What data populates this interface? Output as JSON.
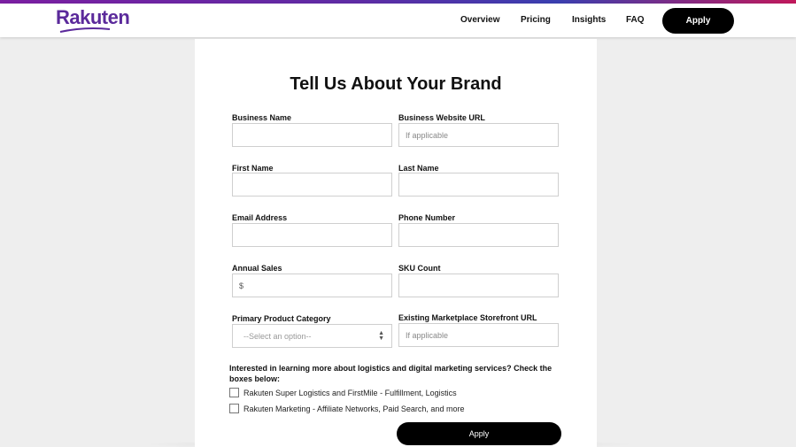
{
  "header": {
    "logo_text": "Rakuten",
    "nav": {
      "overview": "Overview",
      "pricing": "Pricing",
      "insights": "Insights",
      "faq": "FAQ"
    },
    "apply_label": "Apply"
  },
  "form": {
    "title": "Tell Us About Your Brand",
    "fields": {
      "business_name": {
        "label": "Business Name",
        "placeholder": ""
      },
      "business_website": {
        "label": "Business Website URL",
        "placeholder": "If applicable"
      },
      "first_name": {
        "label": "First Name",
        "placeholder": ""
      },
      "last_name": {
        "label": "Last Name",
        "placeholder": ""
      },
      "email": {
        "label": "Email Address",
        "placeholder": ""
      },
      "phone": {
        "label": "Phone Number",
        "placeholder": ""
      },
      "annual_sales": {
        "label": "Annual Sales",
        "placeholder": "$"
      },
      "sku_count": {
        "label": "SKU Count",
        "placeholder": ""
      },
      "primary_category": {
        "label": "Primary Product Category",
        "value": "--Select an option--"
      },
      "marketplace_url": {
        "label": "Existing Marketplace Storefront URL",
        "placeholder": "If applicable"
      }
    },
    "question": "Interested in learning more about logistics and digital marketing services? Check the boxes below:",
    "checkboxes": {
      "logistics": "Rakuten Super Logistics and FirstMile - Fulfillment, Logistics",
      "marketing": "Rakuten Marketing - Affiliate Networks, Paid Search, and more"
    },
    "submit_label": "Apply"
  },
  "colors": {
    "brand": "#5b2a9b",
    "button": "#000000",
    "background": "#eeeeee"
  }
}
